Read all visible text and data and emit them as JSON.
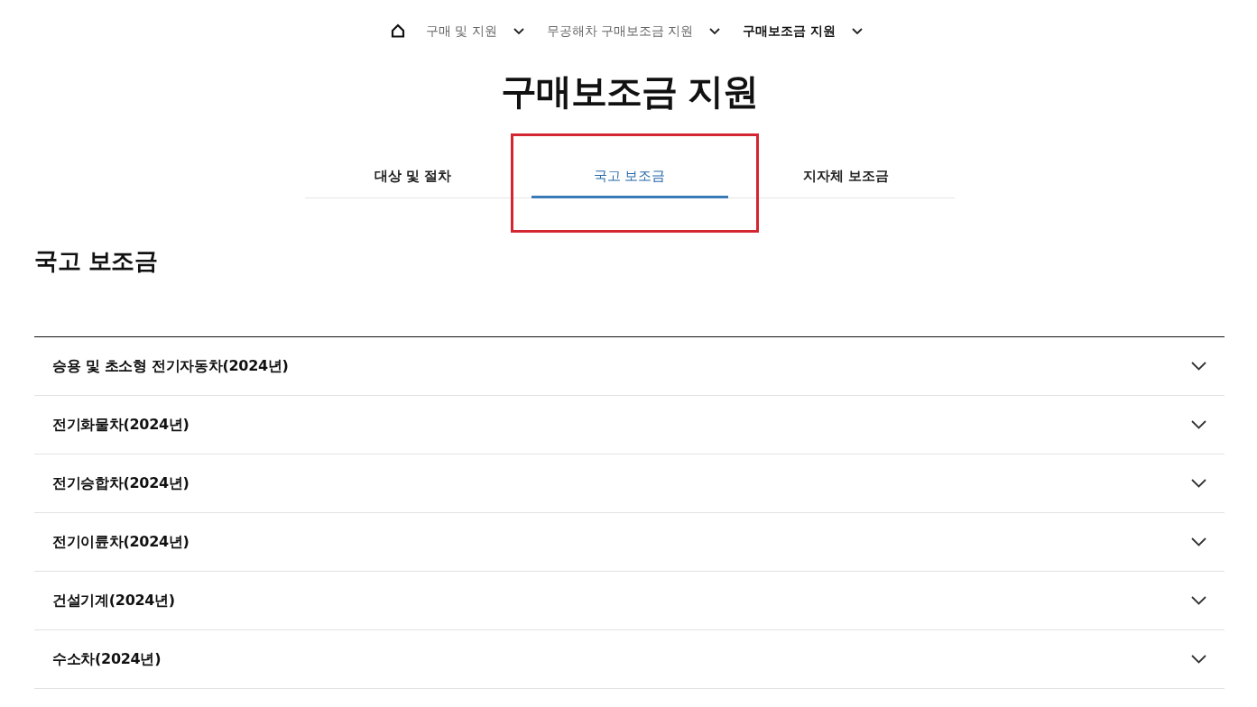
{
  "breadcrumb": [
    {
      "label": "구매 및 지원",
      "current": false
    },
    {
      "label": "무공해차 구매보조금 지원",
      "current": false
    },
    {
      "label": "구매보조금 지원",
      "current": true
    }
  ],
  "title": "구매보조금 지원",
  "tabs": [
    {
      "label": "대상 및 절차",
      "selected": false,
      "highlighted": false
    },
    {
      "label": "국고 보조금",
      "selected": true,
      "highlighted": true
    },
    {
      "label": "지자체 보조금",
      "selected": false,
      "highlighted": false
    }
  ],
  "section_heading": "국고 보조금",
  "accordion": [
    {
      "label": "승용 및 초소형 전기자동차(2024년)",
      "expanded": false
    },
    {
      "label": "전기화물차(2024년)",
      "expanded": false
    },
    {
      "label": "전기승합차(2024년)",
      "expanded": false
    },
    {
      "label": "전기이륜차(2024년)",
      "expanded": false
    },
    {
      "label": "건설기계(2024년)",
      "expanded": false
    },
    {
      "label": "수소차(2024년)",
      "expanded": false
    }
  ]
}
